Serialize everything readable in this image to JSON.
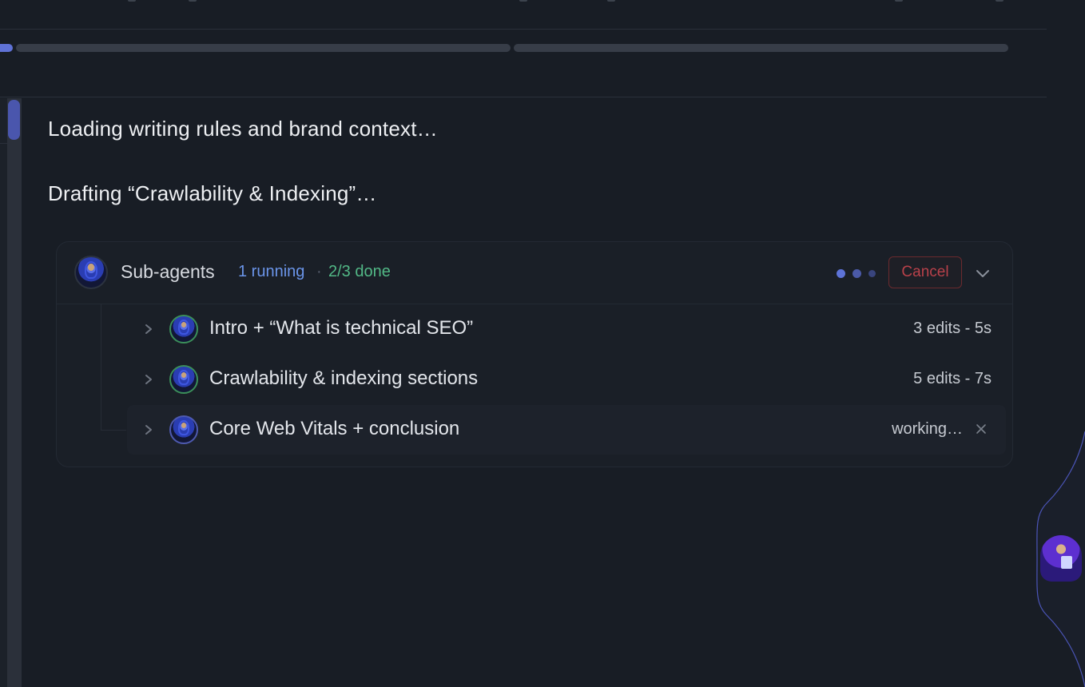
{
  "status": {
    "line1": "Loading writing rules and brand context…",
    "line2": "Drafting “Crawlability & Indexing”…"
  },
  "subagents": {
    "title": "Sub-agents",
    "running": "1 running",
    "separator": "·",
    "done": "2/3 done",
    "cancel_label": "Cancel",
    "icons": {
      "header_avatar": "agent-avatar-icon",
      "collapse": "chevron-down-icon",
      "expand": "chevron-right-icon",
      "close": "close-icon"
    },
    "colors": {
      "running": "#6b95ea",
      "done": "#52b886",
      "cancel": "#b9414a",
      "accent": "#5f72d6"
    },
    "items": [
      {
        "label": "Intro + “What is technical SEO”",
        "meta": "3 edits - 5s",
        "state": "done"
      },
      {
        "label": "Crawlability & indexing sections",
        "meta": "5 edits - 7s",
        "state": "done"
      },
      {
        "label": "Core Web Vitals + conclusion",
        "meta": "working…",
        "state": "running"
      }
    ]
  }
}
